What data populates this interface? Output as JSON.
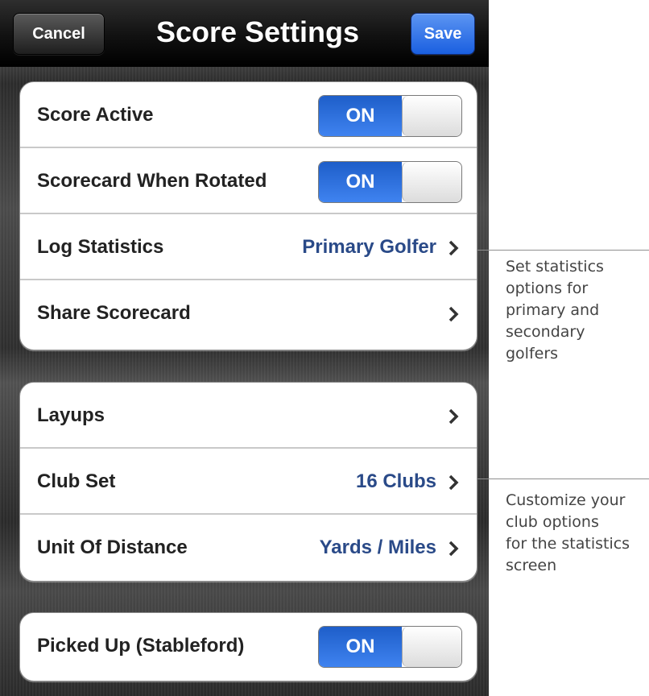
{
  "navbar": {
    "title": "Score Settings",
    "cancel_label": "Cancel",
    "save_label": "Save"
  },
  "groups": [
    {
      "rows": [
        {
          "label": "Score Active",
          "toggle": "ON"
        },
        {
          "label": "Scorecard When Rotated",
          "toggle": "ON"
        },
        {
          "label": "Log Statistics",
          "value": "Primary Golfer",
          "chevron": ">"
        },
        {
          "label": "Share Scorecard",
          "chevron": ">"
        }
      ]
    },
    {
      "rows": [
        {
          "label": "Layups",
          "chevron": ">"
        },
        {
          "label": "Club Set",
          "value": "16 Clubs",
          "chevron": ">"
        },
        {
          "label": "Unit Of Distance",
          "value": "Yards / Miles",
          "chevron": ">"
        }
      ]
    },
    {
      "rows": [
        {
          "label": "Picked Up (Stableford)",
          "toggle": "ON"
        }
      ]
    }
  ],
  "callouts": [
    {
      "lines": [
        "Set statistics",
        "options for",
        "primary and",
        "secondary",
        "golfers"
      ]
    },
    {
      "lines": [
        "Customize your",
        "club options",
        "for the statistics",
        "screen"
      ]
    }
  ],
  "colors": {
    "accent": "#2a65e6",
    "value_text": "#2a4a88",
    "toggle_on": "#2f73e8"
  }
}
